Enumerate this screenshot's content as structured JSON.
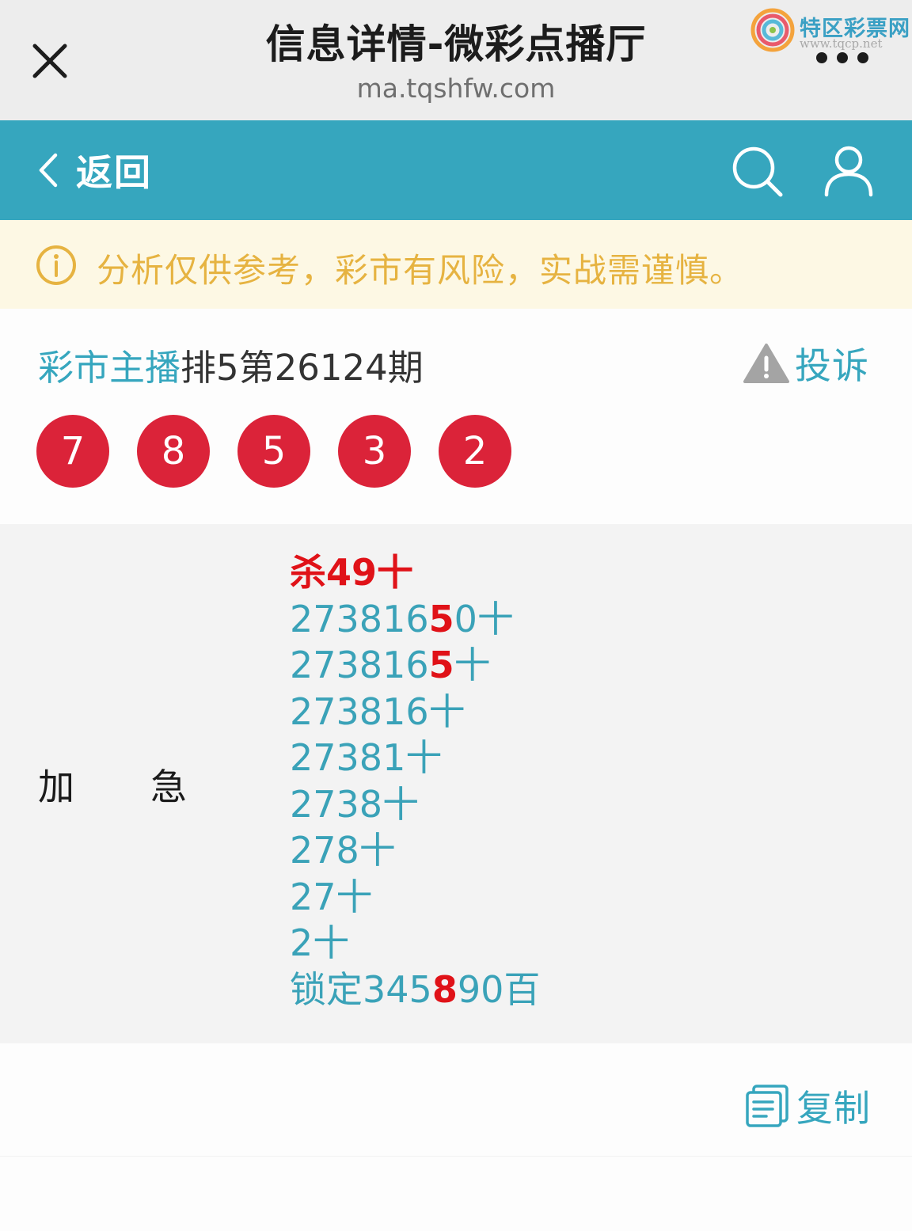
{
  "topbar": {
    "title": "信息详情-微彩点播厅",
    "url": "ma.tqshfw.com",
    "watermark_text": "特区彩票网",
    "watermark_sub": "www.tqcp.net"
  },
  "nav": {
    "back_label": "返回"
  },
  "notice": {
    "text": "分析仅供参考，彩市有风险，实战需谨慎。"
  },
  "post": {
    "anchor": "彩市主播",
    "title": "排5第26124期",
    "complain_label": "投诉"
  },
  "balls": [
    "7",
    "8",
    "5",
    "3",
    "2"
  ],
  "content": {
    "label_left": "加",
    "label_right": "急",
    "kill_line": "杀49十",
    "lines": [
      {
        "pre": "273816",
        "hl": "5",
        "post": "0十"
      },
      {
        "pre": "273816",
        "hl": "5",
        "post": "十"
      },
      {
        "pre": "273816十",
        "hl": "",
        "post": ""
      },
      {
        "pre": "27381十",
        "hl": "",
        "post": ""
      },
      {
        "pre": "2738十",
        "hl": "",
        "post": ""
      },
      {
        "pre": "278十",
        "hl": "",
        "post": ""
      },
      {
        "pre": "27十",
        "hl": "",
        "post": ""
      },
      {
        "pre": "2十",
        "hl": "",
        "post": ""
      },
      {
        "pre": "锁定345",
        "hl": "8",
        "post": "90百"
      }
    ]
  },
  "copy_label": "复制",
  "colors": {
    "teal": "#36a6be",
    "ball_red": "#db2339",
    "highlight_red": "#e01218",
    "notice_text": "#e6b341",
    "notice_bg": "#fdf8e4"
  }
}
